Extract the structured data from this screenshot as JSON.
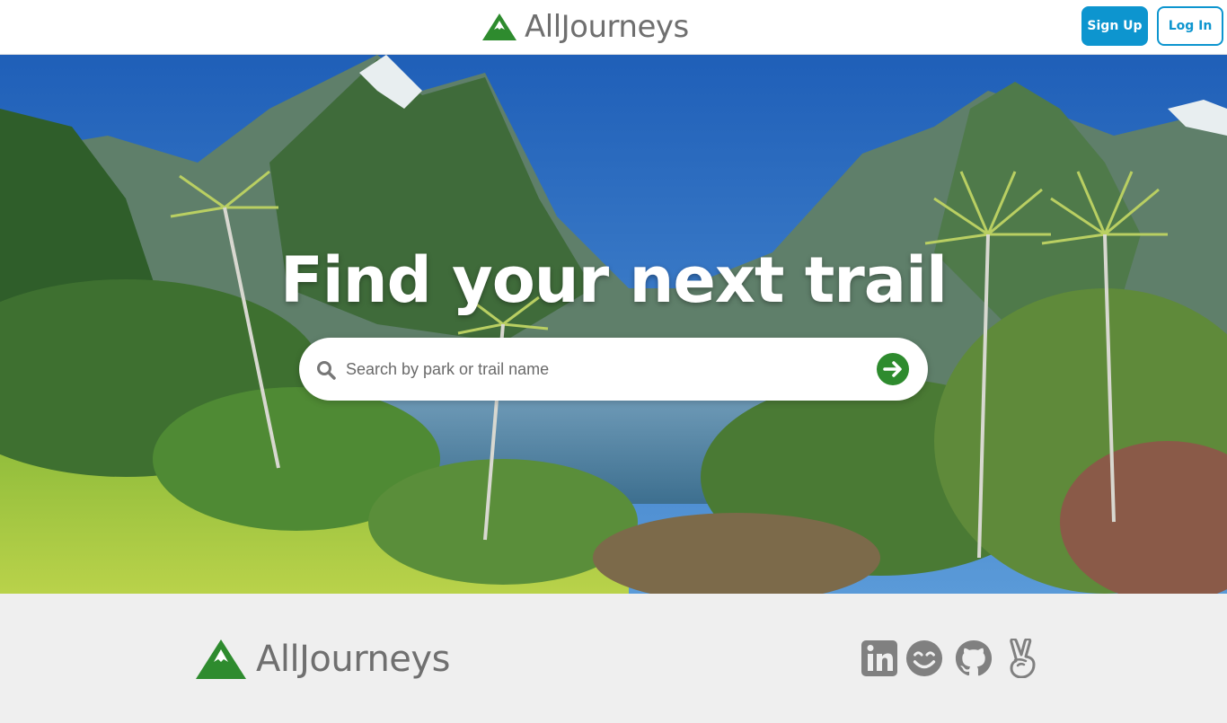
{
  "header": {
    "brand_name": "AllJourneys",
    "signup_label": "Sign Up",
    "login_label": "Log In"
  },
  "hero": {
    "headline": "Find your next trail",
    "search": {
      "placeholder": "Search by park or trail name",
      "value": ""
    }
  },
  "footer": {
    "brand_name": "AllJourneys",
    "social_icons": [
      "linkedin-icon",
      "smile-icon",
      "github-icon",
      "angellist-icon"
    ]
  },
  "colors": {
    "brand_green": "#2e8b2e",
    "accent_blue": "#0d95cf",
    "brand_text": "#6f6f6f",
    "footer_bg": "#efefef",
    "social_icon": "#808080"
  }
}
